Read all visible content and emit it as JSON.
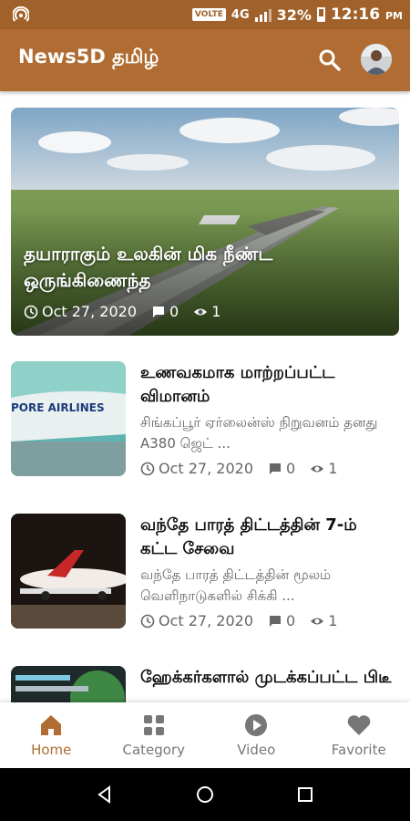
{
  "status_bar": {
    "volte": "VOLTE",
    "network": "4G",
    "battery": "32%",
    "time": "12:16",
    "ampm": "PM"
  },
  "app_bar": {
    "title": "News5D தமிழ்",
    "search_icon": "search-icon",
    "avatar_icon": "profile-avatar"
  },
  "featured": {
    "title": "தயாராகும் உலகின் மிக நீண்ட ஒருங்கிணைந்த",
    "date": "Oct 27, 2020",
    "comments": "0",
    "views": "1"
  },
  "articles": [
    {
      "title": "உணவகமாக மாற்றப்பட்ட விமானம்",
      "desc": "சிங்கப்பூர் ஏர்லைன்ஸ் நிறுவனம் தனது A380 ஜெட் ...",
      "date": "Oct 27, 2020",
      "comments": "0",
      "views": "1",
      "thumb_text": "PORE AIRLINES"
    },
    {
      "title": "வந்தே பாரத் திட்டத்தின் 7-ம் கட்ட சேவை",
      "desc": "வந்தே பாரத் திட்டத்தின் மூலம் வெளிநாடுகளில் சிக்கி ...",
      "date": "Oct 27, 2020",
      "comments": "0",
      "views": "1"
    },
    {
      "title": "ஹேக்கர்களால் முடக்கப்பட்ட பிடீ"
    }
  ],
  "bottom_nav": [
    {
      "label": "Home",
      "icon": "home-icon",
      "active": true
    },
    {
      "label": "Category",
      "icon": "grid-icon",
      "active": false
    },
    {
      "label": "Video",
      "icon": "play-icon",
      "active": false
    },
    {
      "label": "Favorite",
      "icon": "heart-icon",
      "active": false
    }
  ],
  "colors": {
    "status_bar": "#a0622a",
    "app_bar": "#b06c32",
    "accent": "#b06c32"
  }
}
